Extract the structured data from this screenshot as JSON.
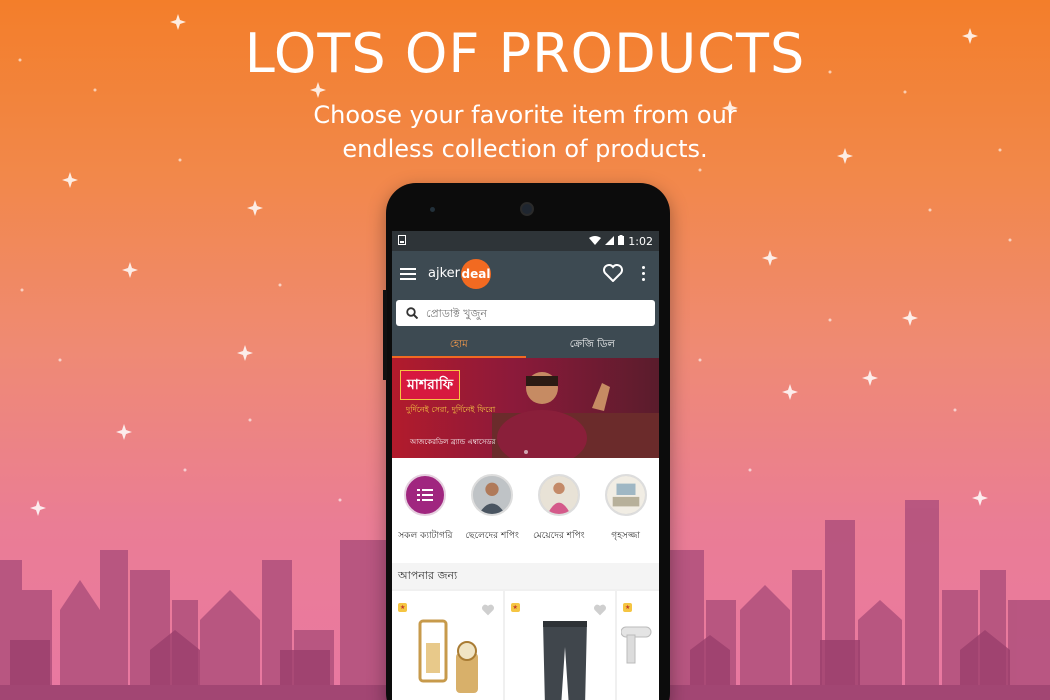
{
  "promo": {
    "headline": "LOTS OF PRODUCTS",
    "subline_1": "Choose your favorite item from our",
    "subline_2": "endless collection of products."
  },
  "statusbar": {
    "time": "1:02"
  },
  "appbar": {
    "logo_part1": "ajker",
    "logo_part2": "deal",
    "heart_icon": "heart-outline-icon",
    "overflow_icon": "more-vert-icon",
    "menu_icon": "hamburger-menu-icon"
  },
  "search": {
    "placeholder": "প্রোডাক্ট খুজুন",
    "icon": "search-icon"
  },
  "tabs": [
    {
      "label": "হোম",
      "active": true
    },
    {
      "label": "ক্রেজি ডিল",
      "active": false
    }
  ],
  "banner": {
    "title": "মাশরাফি",
    "subtitle": "দুর্দিনেই সেরা, দুর্দিনেই ফিরো",
    "footer": "আজকেরডিল ব্র্যান্ড এম্বাসেডর"
  },
  "categories": [
    {
      "label": "সকল ক্যাটাগরি",
      "icon": "list-icon"
    },
    {
      "label": "ছেলেদের শপিং",
      "icon": "men-photo"
    },
    {
      "label": "মেয়েদের শপিং",
      "icon": "women-photo"
    },
    {
      "label": "গৃহসজ্জা",
      "icon": "home-decor-photo"
    }
  ],
  "section": {
    "title": "আপনার জন্য"
  },
  "colors": {
    "accent": "#f26a21",
    "appbar": "#3d4a52",
    "category_primary": "#a0267f"
  }
}
